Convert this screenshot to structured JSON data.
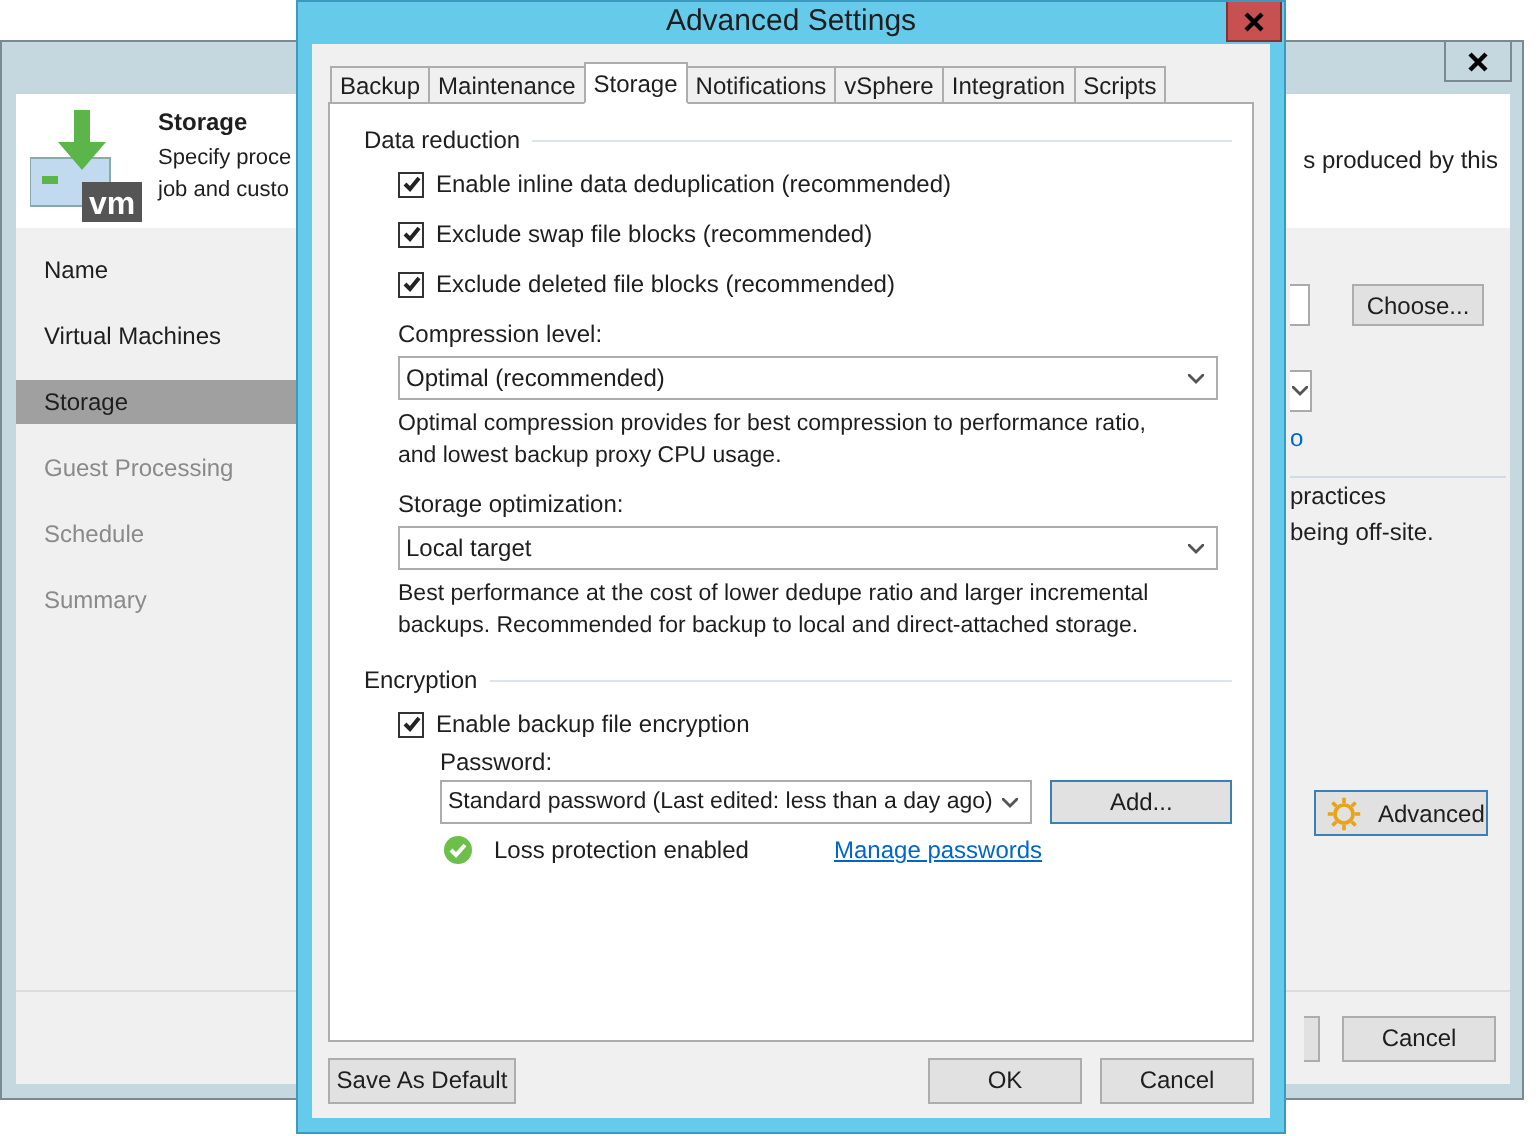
{
  "back_window": {
    "header": {
      "icon_text": "vm",
      "title": "Storage",
      "description_lines": [
        "Specify proce",
        "job and custo"
      ],
      "description_right": "s produced by this"
    },
    "steps": [
      {
        "label": "Name",
        "selected": false,
        "disabled": false
      },
      {
        "label": "Virtual Machines",
        "selected": false,
        "disabled": false
      },
      {
        "label": "Storage",
        "selected": true,
        "disabled": false
      },
      {
        "label": "Guest Processing",
        "selected": false,
        "disabled": true
      },
      {
        "label": "Schedule",
        "selected": false,
        "disabled": true
      },
      {
        "label": "Summary",
        "selected": false,
        "disabled": true
      }
    ],
    "choose_button": "Choose...",
    "link_fragment": "o",
    "info_lines": [
      "practices",
      "being off-site."
    ],
    "advanced_button": "Advanced",
    "cancel_button": "Cancel"
  },
  "dialog": {
    "title": "Advanced Settings",
    "tabs": [
      {
        "label": "Backup",
        "selected": false
      },
      {
        "label": "Maintenance",
        "selected": false
      },
      {
        "label": "Storage",
        "selected": true
      },
      {
        "label": "Notifications",
        "selected": false
      },
      {
        "label": "vSphere",
        "selected": false
      },
      {
        "label": "Integration",
        "selected": false
      },
      {
        "label": "Scripts",
        "selected": false
      }
    ],
    "data_reduction": {
      "heading": "Data reduction",
      "options": [
        {
          "label": "Enable inline data deduplication (recommended)",
          "checked": true
        },
        {
          "label": "Exclude swap file blocks (recommended)",
          "checked": true
        },
        {
          "label": "Exclude deleted file blocks (recommended)",
          "checked": true
        }
      ]
    },
    "compression": {
      "label": "Compression level:",
      "value": "Optimal (recommended)",
      "description_lines": [
        "Optimal compression provides for best compression to performance ratio,",
        "and lowest backup proxy CPU usage."
      ]
    },
    "storage_optimization": {
      "label": "Storage optimization:",
      "value": "Local target",
      "description_lines": [
        "Best performance at the cost of lower dedupe ratio and larger incremental",
        "backups. Recommended for backup to local and direct-attached storage."
      ]
    },
    "encryption": {
      "heading": "Encryption",
      "enable": {
        "label": "Enable backup file encryption",
        "checked": true
      },
      "password_label": "Password:",
      "password_value": "Standard password (Last edited: less than a day ago)",
      "add_button": "Add...",
      "status": "Loss protection enabled",
      "manage_link": "Manage passwords"
    },
    "buttons": {
      "save_default": "Save As Default",
      "ok": "OK",
      "cancel": "Cancel"
    }
  }
}
